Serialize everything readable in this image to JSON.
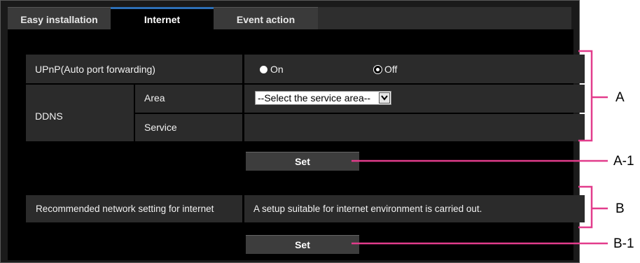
{
  "tabs": [
    {
      "label": "Easy installation"
    },
    {
      "label": "Internet"
    },
    {
      "label": "Event action"
    }
  ],
  "upnp": {
    "label": "UPnP(Auto port forwarding)",
    "option_on": "On",
    "option_off": "Off",
    "selected": "Off"
  },
  "ddns": {
    "label": "DDNS",
    "area_label": "Area",
    "area_value": "--Select the service area--",
    "service_label": "Service"
  },
  "set_button_1": "Set",
  "recommended": {
    "label": "Recommended network setting for internet",
    "description": "A setup suitable for internet environment is carried out."
  },
  "set_button_2": "Set",
  "annotations": {
    "a": "A",
    "a1": "A-1",
    "b": "B",
    "b1": "B-1"
  },
  "colors": {
    "callout": "#e23c8c",
    "active_tab_accent": "#2d6fb7"
  }
}
